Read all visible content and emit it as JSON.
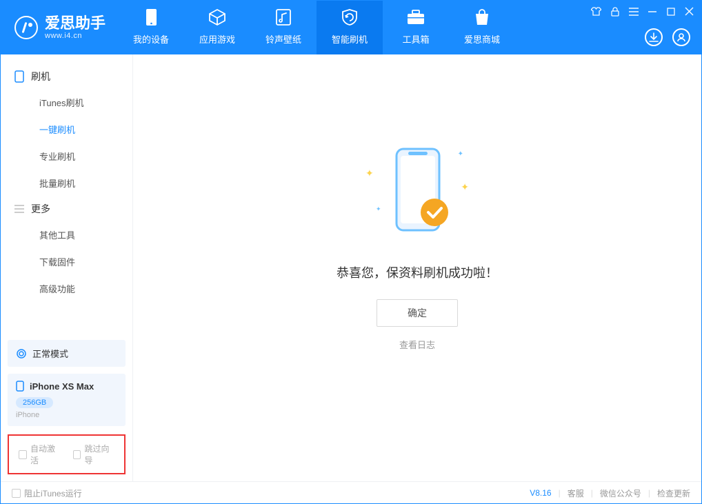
{
  "app": {
    "name": "爱思助手",
    "url": "www.i4.cn"
  },
  "tabs": {
    "device": "我的设备",
    "apps": "应用游戏",
    "ringtones": "铃声壁纸",
    "flash": "智能刷机",
    "toolbox": "工具箱",
    "store": "爱思商城"
  },
  "sidebar": {
    "section_flash": "刷机",
    "items_flash": {
      "itunes": "iTunes刷机",
      "oneclick": "一键刷机",
      "pro": "专业刷机",
      "batch": "批量刷机"
    },
    "section_more": "更多",
    "items_more": {
      "other": "其他工具",
      "firmware": "下载固件",
      "advanced": "高级功能"
    }
  },
  "device": {
    "mode": "正常模式",
    "name": "iPhone XS Max",
    "capacity": "256GB",
    "type": "iPhone"
  },
  "checks": {
    "auto_activate": "自动激活",
    "skip_guide": "跳过向导"
  },
  "main": {
    "success": "恭喜您，保资料刷机成功啦！",
    "ok": "确定",
    "view_log": "查看日志"
  },
  "footer": {
    "block_itunes": "阻止iTunes运行",
    "version": "V8.16",
    "support": "客服",
    "wechat": "微信公众号",
    "check_update": "检查更新"
  }
}
